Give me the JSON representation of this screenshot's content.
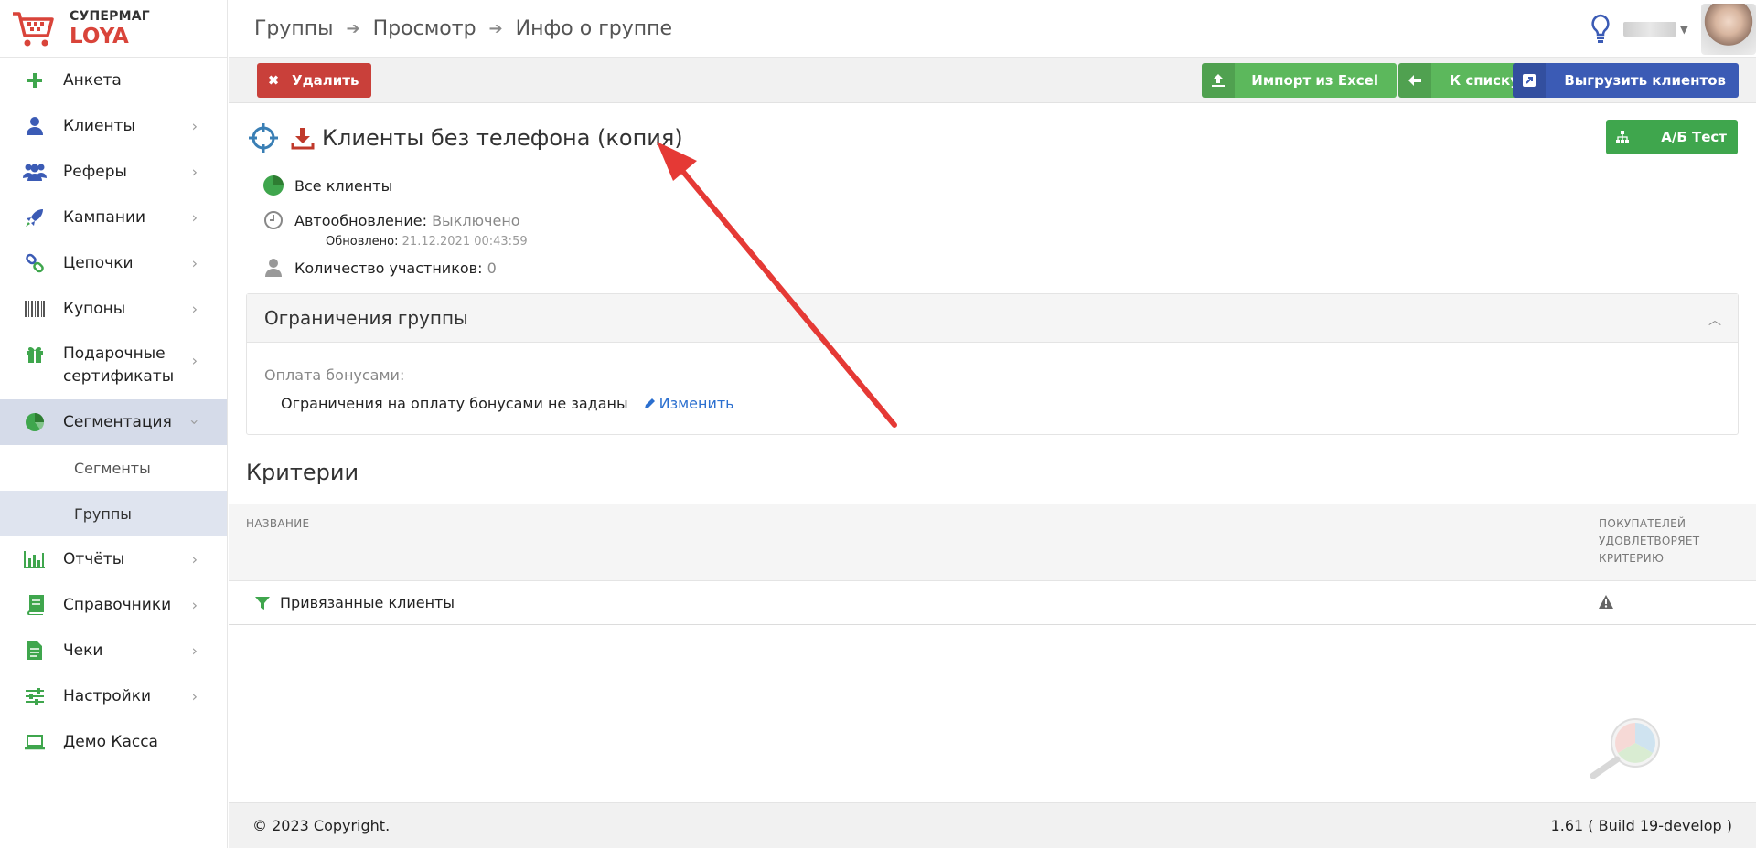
{
  "brand": {
    "line1": "СУПЕРМАГ",
    "line2": "LOYA"
  },
  "sidebar": {
    "items": [
      {
        "label": "Анкета",
        "icon": "plus-icon",
        "chevron": false
      },
      {
        "label": "Клиенты",
        "icon": "user-icon",
        "chevron": true
      },
      {
        "label": "Реферы",
        "icon": "users-icon",
        "chevron": true
      },
      {
        "label": "Кампании",
        "icon": "rocket-icon",
        "chevron": true
      },
      {
        "label": "Цепочки",
        "icon": "chain-icon",
        "chevron": true
      },
      {
        "label": "Купоны",
        "icon": "barcode-icon",
        "chevron": true
      },
      {
        "label": "Подарочные сертификаты",
        "icon": "gift-icon",
        "chevron": true
      },
      {
        "label": "Сегментация",
        "icon": "pie-icon",
        "chevron": true,
        "active": true
      },
      {
        "label": "Отчёты",
        "icon": "bar-chart-icon",
        "chevron": true
      },
      {
        "label": "Справочники",
        "icon": "book-icon",
        "chevron": true
      },
      {
        "label": "Чеки",
        "icon": "receipt-icon",
        "chevron": true
      },
      {
        "label": "Настройки",
        "icon": "sliders-icon",
        "chevron": true
      },
      {
        "label": "Демо Касса",
        "icon": "laptop-icon",
        "chevron": false
      }
    ],
    "sub_items": [
      {
        "label": "Сегменты"
      },
      {
        "label": "Группы",
        "active": true
      }
    ]
  },
  "breadcrumb": [
    "Группы",
    "Просмотр",
    "Инфо о группе"
  ],
  "toolbar": {
    "delete_label": "Удалить",
    "import_label": "Импорт из Excel",
    "to_list_label": "К списку",
    "export_label": "Выгрузить клиентов"
  },
  "group": {
    "title": "Клиенты без телефона (копия)",
    "ab_test_label": "А/Б Тест",
    "scope": "Все клиенты",
    "autoupdate_label": "Автообновление:",
    "autoupdate_value": "Выключено",
    "updated_label": "Обновлено:",
    "updated_value": "21.12.2021 00:43:59",
    "members_label": "Количество участников:",
    "members_value": "0"
  },
  "limits_panel": {
    "title": "Ограничения группы",
    "bonus_label": "Оплата бонусами:",
    "bonus_text": "Ограничения на оплату бонусами не заданы",
    "edit_label": "Изменить"
  },
  "criteria": {
    "title": "Критерии",
    "col_name": "НАЗВАНИЕ",
    "col_buyers": "ПОКУПАТЕЛЕЙ УДОВЛЕТВОРЯЕТ КРИТЕРИЮ",
    "rows": [
      {
        "name": "Привязанные клиенты",
        "status_icon": "warning-icon"
      }
    ]
  },
  "footer": {
    "copyright": "© 2023 Copyright.",
    "version": "1.61 ( Build 19-develop )"
  },
  "colors": {
    "red": "#c9403a",
    "green": "#5cb85c",
    "blue": "#3b5bb5",
    "active_menu": "#d5dbe9",
    "link": "#2b6fcf",
    "arrow": "#e53935"
  }
}
